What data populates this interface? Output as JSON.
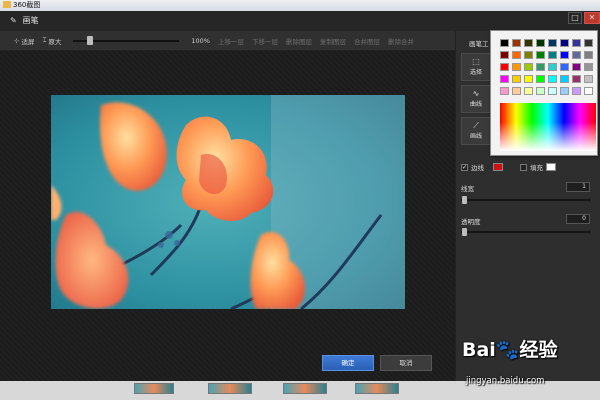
{
  "outer": {
    "title": "360截图"
  },
  "dialog": {
    "title": "画笔",
    "minimize_glyph": "□",
    "close_glyph": "✕"
  },
  "toolbar": {
    "fullscreen": "适屏",
    "enlarge": "原大",
    "zoom": "100%",
    "zoom_fraction": 0.14,
    "prev": "上移一层",
    "next": "下移一层",
    "delete_layer": "删除图层",
    "copy_layer": "复制图层",
    "merge_layer": "合并图层",
    "delete_merge": "删除合并"
  },
  "panel": {
    "title": "画笔工",
    "tools": [
      {
        "glyph": "⬚",
        "label": "选择"
      },
      {
        "glyph": "∿",
        "label": "曲线"
      },
      {
        "glyph": "⟋",
        "label": "画线"
      }
    ],
    "border_label": "边线",
    "border_checked": "✓",
    "fill_label": "填充",
    "line_width_label": "线宽",
    "line_width_value": "1",
    "opacity_label": "透明度",
    "opacity_value": "0",
    "border_color": "#d01010",
    "fill_color": "#ffffff"
  },
  "palette": {
    "colors": [
      "#000000",
      "#993300",
      "#333300",
      "#003300",
      "#003366",
      "#000080",
      "#333399",
      "#333333",
      "#800000",
      "#ff6600",
      "#808000",
      "#008000",
      "#008080",
      "#0000ff",
      "#666699",
      "#808080",
      "#ff0000",
      "#ff9900",
      "#99cc00",
      "#339966",
      "#33cccc",
      "#3366ff",
      "#800080",
      "#969696",
      "#ff00ff",
      "#ffcc00",
      "#ffff00",
      "#00ff00",
      "#00ffff",
      "#00ccff",
      "#993366",
      "#c0c0c0",
      "#ff99cc",
      "#ffcc99",
      "#ffff99",
      "#ccffcc",
      "#ccffff",
      "#99ccff",
      "#cc99ff",
      "#ffffff"
    ]
  },
  "buttons": {
    "ok": "确定",
    "cancel": "取消"
  },
  "watermark": {
    "logo": "Bai🐾经验",
    "url": "jingyan.baidu.com"
  }
}
